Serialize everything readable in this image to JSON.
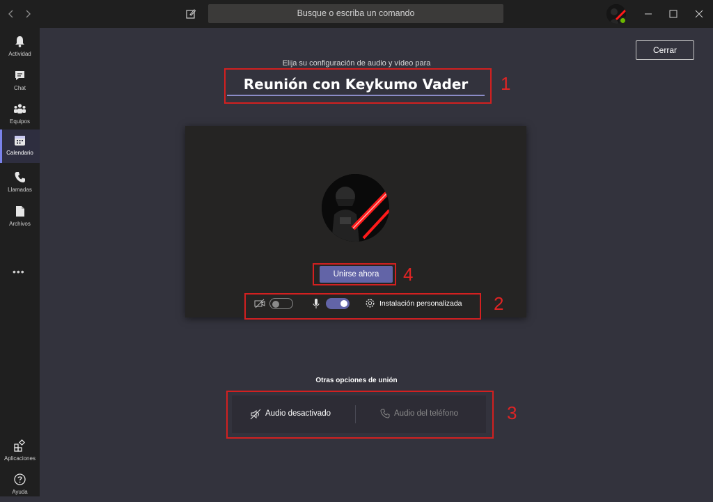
{
  "titlebar": {
    "search_placeholder": "Busque o escriba un comando",
    "icons": [
      "back-icon",
      "forward-icon",
      "compose-icon",
      "minimize-icon",
      "maximize-icon",
      "close-window-icon"
    ]
  },
  "rail": {
    "items": [
      {
        "label": "Actividad",
        "icon": "bell-icon"
      },
      {
        "label": "Chat",
        "icon": "chat-icon"
      },
      {
        "label": "Equipos",
        "icon": "teams-icon"
      },
      {
        "label": "Calendario",
        "icon": "calendar-icon",
        "active": true
      },
      {
        "label": "Llamadas",
        "icon": "phone-icon"
      },
      {
        "label": "Archivos",
        "icon": "file-icon"
      }
    ],
    "more": "•••",
    "bottom": [
      {
        "label": "Aplicaciones",
        "icon": "apps-icon"
      },
      {
        "label": "Ayuda",
        "icon": "help-icon"
      }
    ]
  },
  "main": {
    "close_label": "Cerrar",
    "subtitle": "Elija su configuración de audio y vídeo para",
    "meeting_name": "Reunión con Keykumo Vader",
    "join_label": "Unirse ahora",
    "camera_on": false,
    "mic_on": true,
    "custom_setup_label": "Instalación personalizada",
    "other_options_title": "Otras opciones de unión",
    "audio_off_label": "Audio desactivado",
    "phone_audio_label": "Audio del teléfono"
  },
  "annotations": {
    "n1": "1",
    "n2": "2",
    "n3": "3",
    "n4": "4"
  },
  "colors": {
    "accent": "#6264a7",
    "annotation": "#d32020",
    "background": "#33333d",
    "rail": "#1f1f1f"
  }
}
